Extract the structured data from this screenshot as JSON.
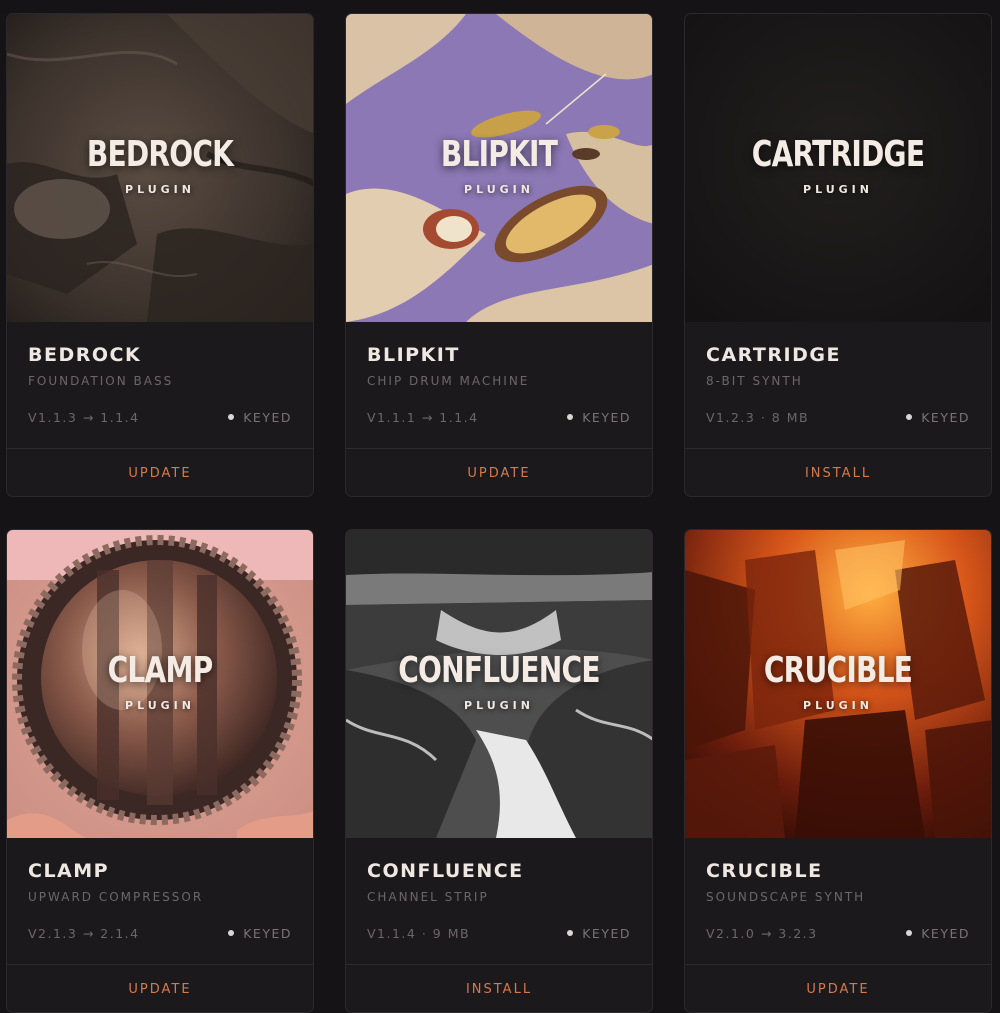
{
  "plugins": [
    {
      "art_title": "BEDROCK",
      "art_subtitle": "PLUGIN",
      "name": "BEDROCK",
      "description": "FOUNDATION BASS",
      "version": "V1.1.3 → 1.1.4",
      "status": "KEYED",
      "action": "UPDATE"
    },
    {
      "art_title": "BLIPKIT",
      "art_subtitle": "PLUGIN",
      "name": "BLIPKIT",
      "description": "CHIP DRUM MACHINE",
      "version": "V1.1.1 → 1.1.4",
      "status": "KEYED",
      "action": "UPDATE"
    },
    {
      "art_title": "CARTRIDGE",
      "art_subtitle": "PLUGIN",
      "name": "CARTRIDGE",
      "description": "8-BIT SYNTH",
      "version": "V1.2.3 · 8 MB",
      "status": "KEYED",
      "action": "INSTALL"
    },
    {
      "art_title": "CLAMP",
      "art_subtitle": "PLUGIN",
      "name": "CLAMP",
      "description": "UPWARD COMPRESSOR",
      "version": "V2.1.3 → 2.1.4",
      "status": "KEYED",
      "action": "UPDATE"
    },
    {
      "art_title": "CONFLUENCE",
      "art_subtitle": "PLUGIN",
      "name": "CONFLUENCE",
      "description": "CHANNEL STRIP",
      "version": "V1.1.4 · 9 MB",
      "status": "KEYED",
      "action": "INSTALL"
    },
    {
      "art_title": "CRUCIBLE",
      "art_subtitle": "PLUGIN",
      "name": "CRUCIBLE",
      "description": "SOUNDSCAPE SYNTH",
      "version": "V2.1.0 → 3.2.3",
      "status": "KEYED",
      "action": "UPDATE"
    }
  ],
  "colors": {
    "background": "#151316",
    "card": "#1c191c",
    "accent": "#d57a4a",
    "keyed_dot": "#ddd6d0"
  }
}
